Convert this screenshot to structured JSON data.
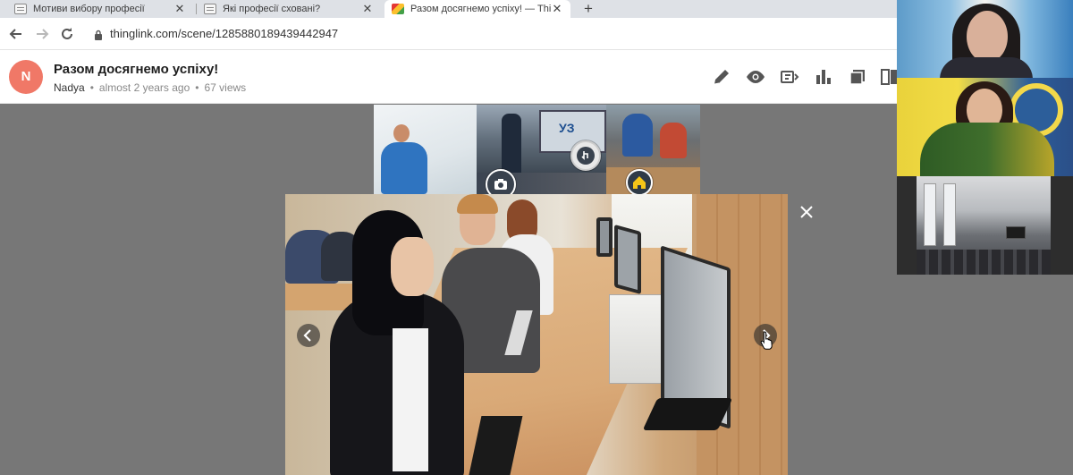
{
  "browser": {
    "tabs": [
      {
        "title": "Мотиви вибору професії",
        "active": false
      },
      {
        "title": "Які професії сховані?",
        "active": false
      },
      {
        "title": "Разом досягнемо успіху! — ThingLink",
        "active": true
      }
    ],
    "new_tab": "+",
    "close_glyph": "✕",
    "url": "thinglink.com/scene/1285880189439442947"
  },
  "scene": {
    "avatar_letter": "N",
    "title": "Разом досягнемо успіху!",
    "author": "Nadya",
    "separator": "•",
    "time": "almost 2 years ago",
    "views": "67 views"
  },
  "actions": [
    "edit-icon",
    "preview-icon",
    "share-icon",
    "stats-icon",
    "copy-icon",
    "more-icon"
  ],
  "lightbox": {
    "close_glyph": "✕",
    "prev_glyph": "‹",
    "next_glyph": "›"
  },
  "colors": {
    "avatar": "#f07867",
    "canvas": "#777777"
  }
}
